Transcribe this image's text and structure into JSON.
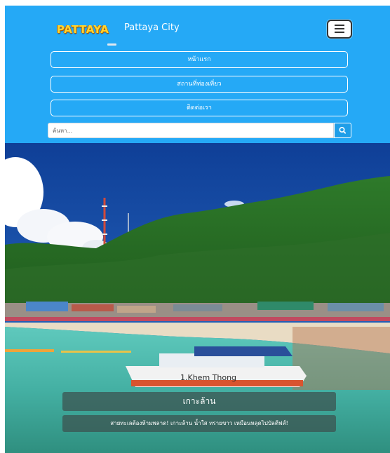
{
  "navbar": {
    "logo_text": "PATTAYA",
    "brand": "Pattaya City",
    "links": [
      "หน้าแรก",
      "สถานที่ท่องเที่ยว",
      "ติดต่อเรา"
    ]
  },
  "search": {
    "placeholder": "ค้นหา..."
  },
  "hero": {
    "title": "เกาะล้าน",
    "subtitle": "สายทะเลต้องห้ามพลาด! เกาะล้าน น้ำใส ทรายขาว เหมือนหลุดไปบัลดีฟส์!"
  },
  "icons": {
    "toggler": "menu-icon",
    "search": "search-icon"
  },
  "colors": {
    "navbar_bg": "#25a9f6",
    "search_button": "#1e9ee8",
    "logo": "#ffd52e"
  }
}
